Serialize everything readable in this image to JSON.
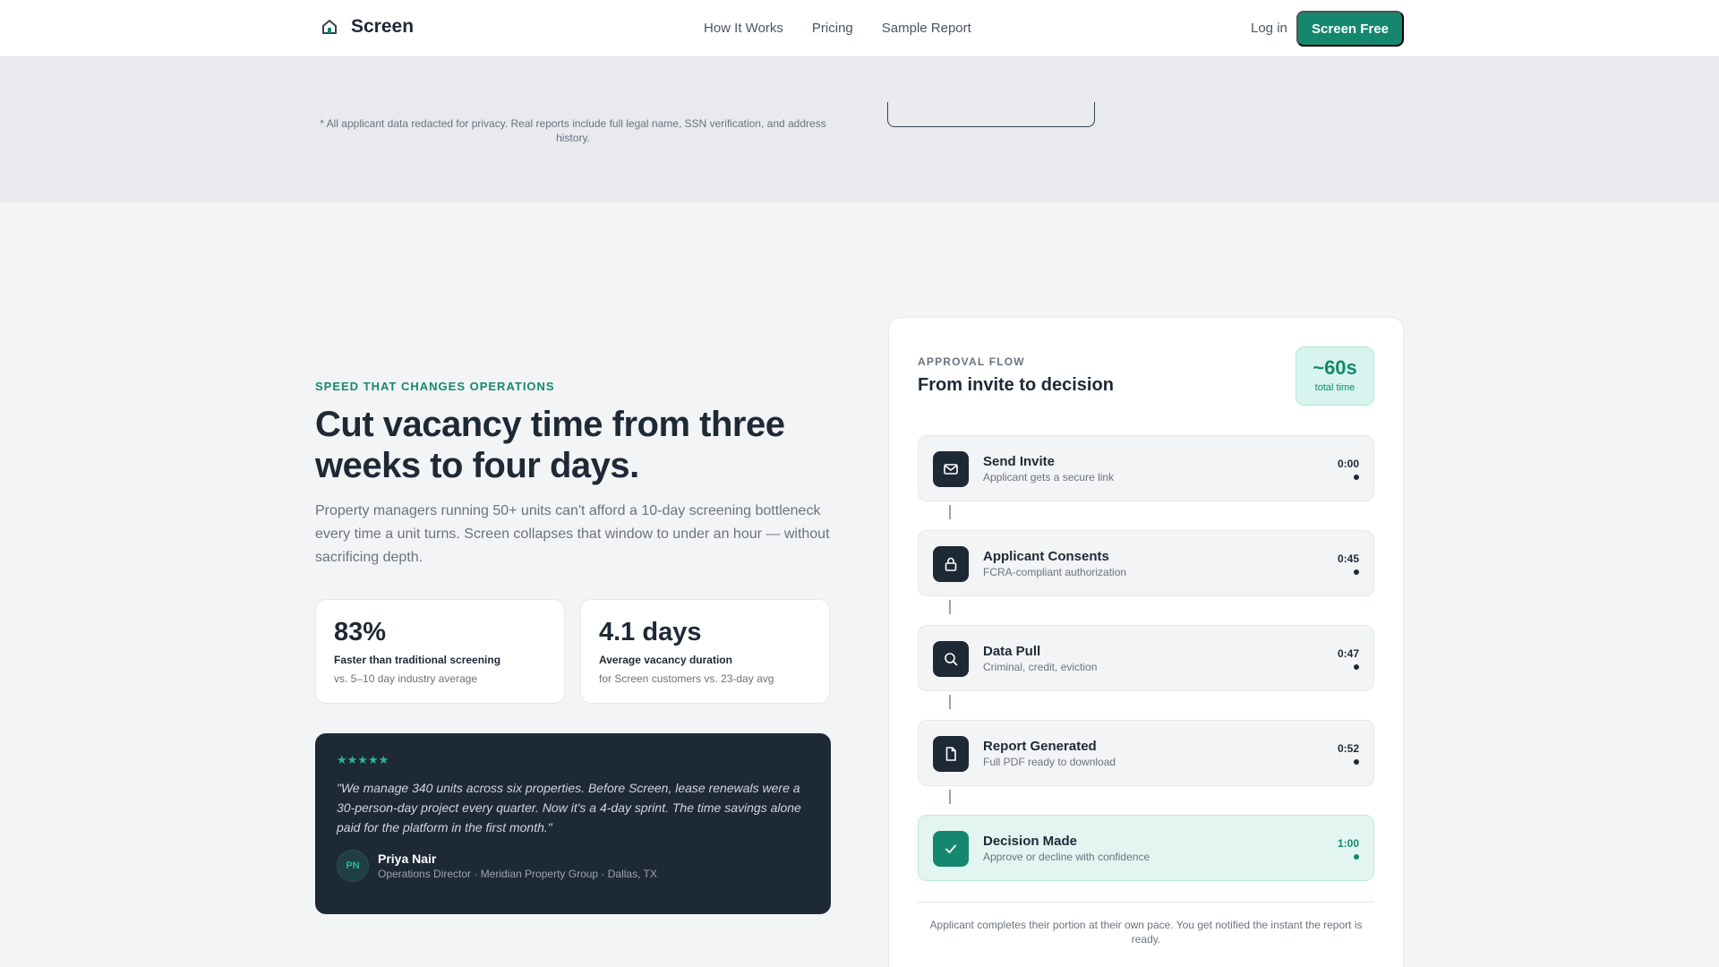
{
  "header": {
    "brand": "Screen",
    "brand_icon": "house-icon",
    "nav_links": [
      "How It Works",
      "Pricing",
      "Sample Report"
    ],
    "login": "Log in",
    "cta": "Screen Free"
  },
  "top_strip": {
    "disclaimer": "* All applicant data redacted for privacy. Real reports include full legal name, SSN verification, and address history."
  },
  "hero": {
    "eyebrow": "SPEED THAT CHANGES OPERATIONS",
    "headline": "Cut vacancy time from three weeks to four days.",
    "lead": "Property managers running 50+ units can't afford a 10-day screening bottleneck every time a unit turns. Screen collapses that window to under an hour — without sacrificing depth."
  },
  "stats": [
    {
      "value": "83%",
      "label": "Faster than traditional screening",
      "sub": "vs. 5–10 day industry average"
    },
    {
      "value": "4.1 days",
      "label": "Average vacancy duration",
      "sub": "for Screen customers vs. 23-day avg"
    }
  ],
  "testimonial": {
    "rating": 5,
    "stars": "★★★★★",
    "quote": "\"We manage 340 units across six properties. Before Screen, lease renewals were a 30-person-day project every quarter. Now it's a 4-day sprint. The time savings alone paid for the platform in the first month.\"",
    "initials": "PN",
    "name": "Priya Nair",
    "role": "Operations Director · Meridian Property Group · Dallas, TX"
  },
  "flow": {
    "eyebrow": "APPROVAL FLOW",
    "title": "From invite to decision",
    "total_value": "~60s",
    "total_label": "total time",
    "steps": [
      {
        "title": "Send Invite",
        "sub": "Applicant gets a secure link",
        "time": "0:00",
        "icon": "mail-icon"
      },
      {
        "title": "Applicant Consents",
        "sub": "FCRA-compliant authorization",
        "time": "0:45",
        "icon": "lock-icon"
      },
      {
        "title": "Data Pull",
        "sub": "Criminal, credit, eviction",
        "time": "0:47",
        "icon": "search-icon"
      },
      {
        "title": "Report Generated",
        "sub": "Full PDF ready to download",
        "time": "0:52",
        "icon": "document-icon"
      },
      {
        "title": "Decision Made",
        "sub": "Approve or decline with confidence",
        "time": "1:00",
        "icon": "check-icon"
      }
    ],
    "note": "Applicant completes their portion at their own pace. You get notified the instant the report is ready."
  },
  "colors": {
    "accent": "#15876f",
    "dark": "#1e2936",
    "muted": "#6b7280",
    "page_bg": "#f3f4f6",
    "strip_bg": "#e8eaed"
  }
}
